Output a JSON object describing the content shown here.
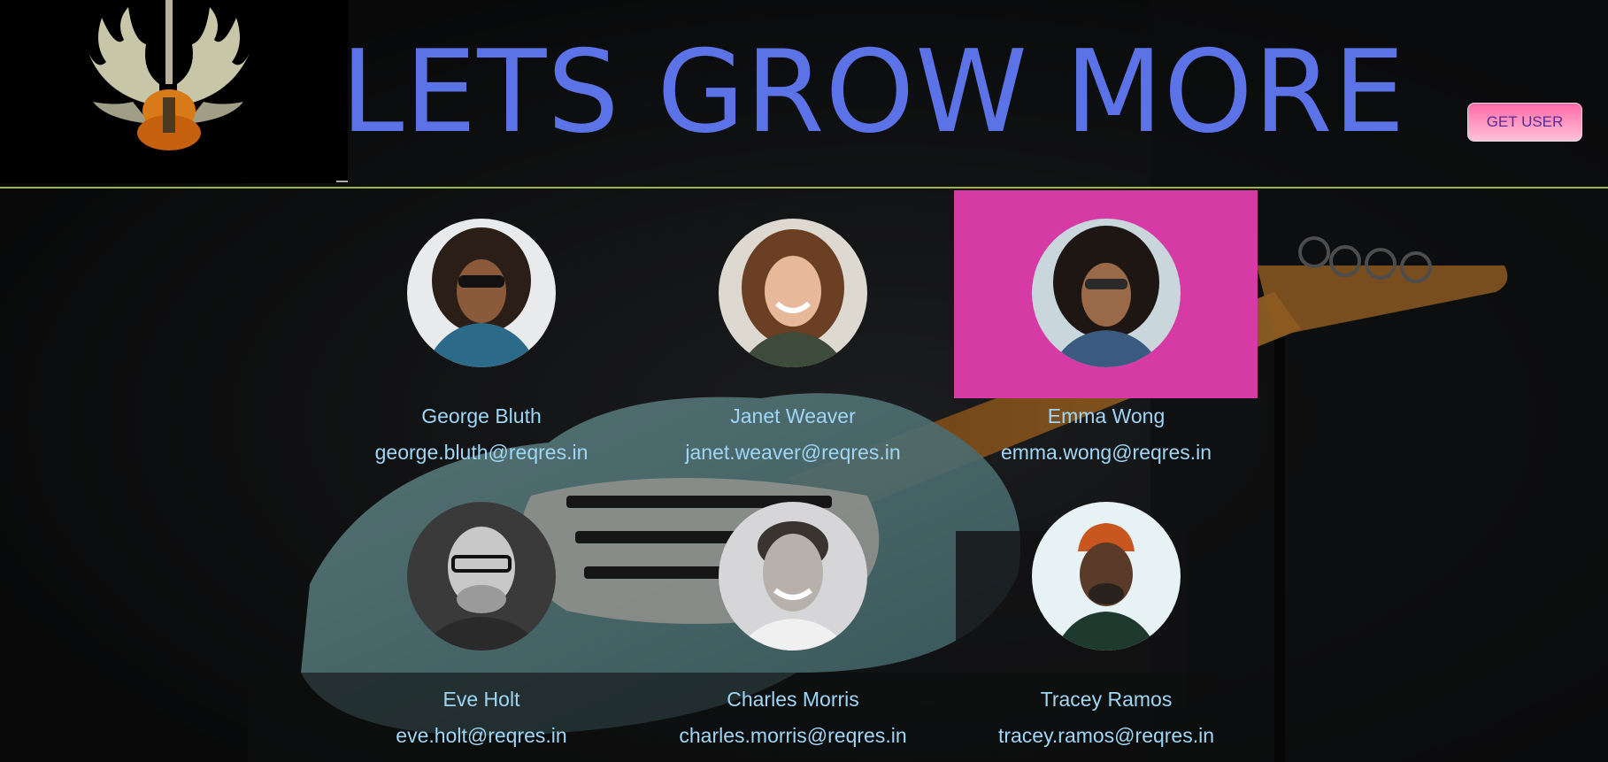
{
  "header": {
    "title": "LETS GROW MORE",
    "get_user_label": "GET USER"
  },
  "users": [
    {
      "name": "George Bluth",
      "email": "george.bluth@reqres.in"
    },
    {
      "name": "Janet Weaver",
      "email": "janet.weaver@reqres.in"
    },
    {
      "name": "Emma Wong",
      "email": "emma.wong@reqres.in"
    },
    {
      "name": "Eve Holt",
      "email": "eve.holt@reqres.in"
    },
    {
      "name": "Charles Morris",
      "email": "charles.morris@reqres.in"
    },
    {
      "name": "Tracey Ramos",
      "email": "tracey.ramos@reqres.in"
    }
  ],
  "colors": {
    "title": "#5b73e6",
    "text": "#9fd6f5",
    "highlight": "#d63aa5",
    "divider": "#9ab542"
  }
}
